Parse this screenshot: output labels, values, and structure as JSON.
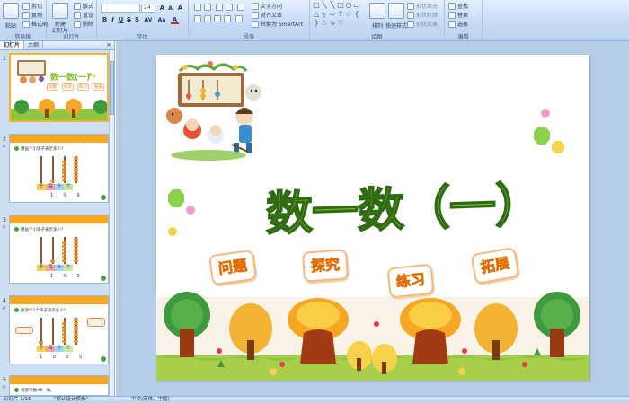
{
  "ribbon": {
    "clipboard": {
      "paste": "粘贴",
      "cut": "剪切",
      "copy": "复制",
      "format_painter": "格式刷",
      "label": "剪贴板"
    },
    "slides": {
      "new_slide": "新建\n幻灯片",
      "layout": "版式",
      "reset": "重设",
      "delete": "删除",
      "label": "幻灯片"
    },
    "font": {
      "font_name": "",
      "font_size": "24",
      "bold": "B",
      "italic": "I",
      "underline": "U",
      "strike": "S",
      "shadow": "S",
      "spacing": "AV",
      "case": "Aa",
      "color": "A",
      "grow": "A",
      "shrink": "A",
      "clear": "A",
      "label": "字体"
    },
    "paragraph": {
      "text_direction": "文字方向",
      "align_text": "对齐文本",
      "smartart": "转换为 SmartArt",
      "label": "段落"
    },
    "drawing": {
      "arrange": "排列",
      "quick_styles": "快速样式",
      "shape_fill": "形状填充",
      "shape_outline": "形状轮廓",
      "shape_effects": "形状效果",
      "label": "绘图"
    },
    "editing": {
      "find": "查找",
      "replace": "替换",
      "select": "选择",
      "label": "编辑"
    }
  },
  "panel": {
    "tab_slides": "幻灯片",
    "tab_outline": "大纲",
    "close": "×"
  },
  "thumbnails": [
    {
      "num": "1",
      "title": "数一数(一)",
      "tags": [
        "问题",
        "探究",
        "练习",
        "拓展"
      ]
    },
    {
      "num": "2",
      "question": "用画个小珠子表示多少?",
      "places": [
        "千",
        "百",
        "十",
        "个"
      ],
      "digits": "1 9 9"
    },
    {
      "num": "3",
      "question": "用画个小珠子表示多少?",
      "places": [
        "千",
        "百",
        "十",
        "个"
      ],
      "digits": "1 9 9"
    },
    {
      "num": "4",
      "question": "再添个1个珠子表示多少?",
      "places": [
        "千",
        "百",
        "十",
        "个"
      ],
      "digits": "1 0 0 0"
    },
    {
      "num": "5",
      "question": "看图写数:填一填。"
    }
  ],
  "slide": {
    "title": "数一数（一）",
    "tags": [
      "问题",
      "探究",
      "练习",
      "拓展"
    ],
    "colors": {
      "title_fill": "#7cc32e",
      "title_stroke": "#2f6a12",
      "tag_text": "#f08020",
      "tag_border": "#f4b980"
    }
  },
  "status": {
    "slide_info": "幻灯片 1/16",
    "theme": "\"默认设计模板\"",
    "language": "中文(简体，中国)"
  }
}
